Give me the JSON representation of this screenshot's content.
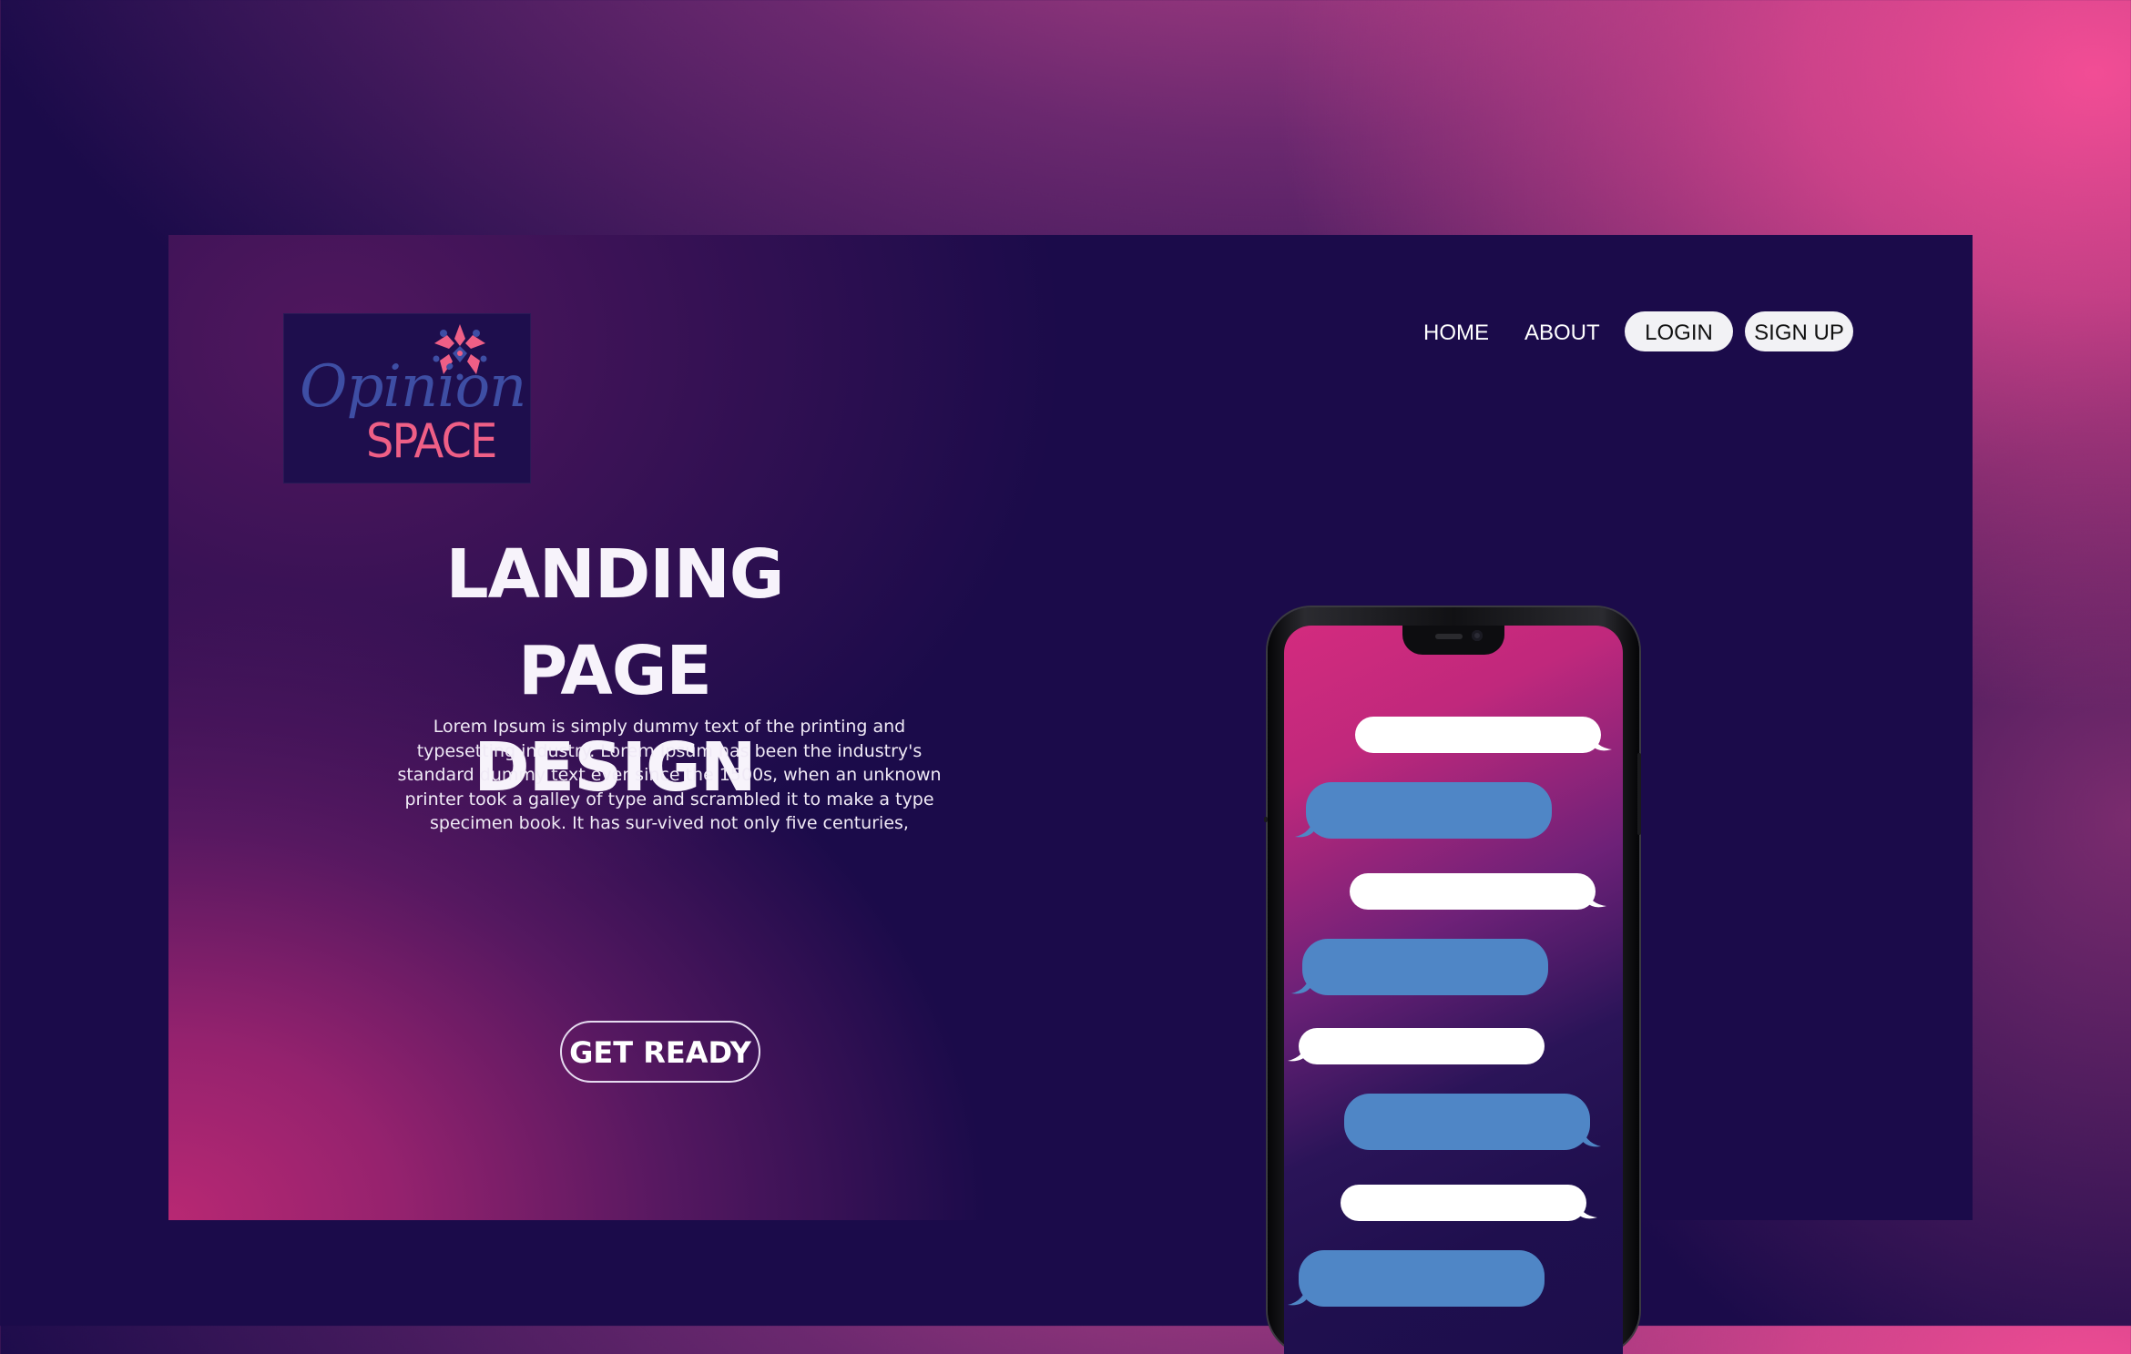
{
  "brand": {
    "name_line1": "Opinion",
    "name_line2": "SPACE",
    "logo_icon": "star-flower-icon",
    "colors": {
      "blue": "#3e4ea4",
      "pink": "#ef5f86"
    }
  },
  "nav": {
    "items": [
      {
        "label": "HOME"
      },
      {
        "label": "ABOUT"
      },
      {
        "label": "LOGIN"
      },
      {
        "label": "SIGN UP"
      }
    ]
  },
  "hero": {
    "title_line1": "LANDING PAGE",
    "title_line2": "DESIGN",
    "description": "Lorem Ipsum is simply dummy text of the printing and typesetting industry. Lorem Ipsum has been the industry's standard dummy text ever since the 1500s, when an unknown printer took a galley of type and scrambled it to make a type specimen book. It has sur-vived not only five centuries,",
    "cta_label": "GET READY"
  },
  "phone": {
    "icon": "smartphone-icon",
    "chat_bubbles": [
      "white",
      "blue",
      "white",
      "blue",
      "white",
      "blue",
      "white",
      "blue"
    ],
    "colors": {
      "white_bubble": "#ffffff",
      "blue_bubble": "#4f86c6"
    }
  },
  "colors": {
    "background": "#1b0b4a",
    "accent_pink": "#f24d95",
    "accent_magenta": "#b82873"
  }
}
